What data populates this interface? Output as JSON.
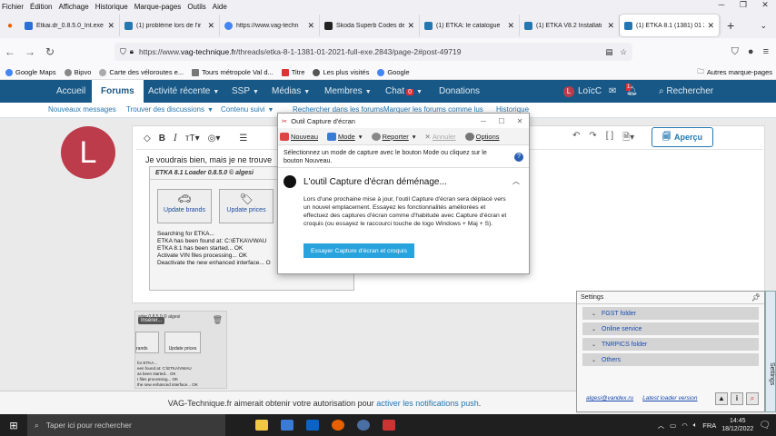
{
  "menubar": {
    "items": [
      "Fichier",
      "Édition",
      "Affichage",
      "Historique",
      "Marque-pages",
      "Outils",
      "Aide"
    ]
  },
  "tabs": [
    {
      "title": "Etkai.dr_0.8.5.0_Int.exe",
      "color": "#2b6fd6"
    },
    {
      "title": "(1) problème lors de l'ir",
      "color": "#2577b1"
    },
    {
      "title": "https://www.vag-techn",
      "color": "#4285f4"
    },
    {
      "title": "Skoda Superb Codes de",
      "color": "#222222"
    },
    {
      "title": "(1) ETKA: le catalogue",
      "color": "#2577b1"
    },
    {
      "title": "(1) ETKA V8.2 Installati",
      "color": "#2577b1"
    },
    {
      "title": "(1) ETKA 8.1 (1381) 01 2",
      "color": "#2577b1"
    }
  ],
  "browser": {
    "url_prefix": "https://www.",
    "url_domain": "vag-technique.fr",
    "url_path": "/threads/etka-8-1-1381-01-2021-full-exe.2843/page-2#post-49719"
  },
  "bookmarks": [
    "Google Maps",
    "Bipvo",
    "Carte des véloroutes e...",
    "Tours métropole Val d...",
    "Titre",
    "Les plus visités",
    "Google"
  ],
  "bookmarks_other": "Autres marque-pages",
  "sitenav": {
    "accueil": "Accueil",
    "forums": "Forums",
    "activite": "Activité récente",
    "ssp": "SSP",
    "medias": "Médias",
    "membres": "Membres",
    "chat": "Chat",
    "chat_badge": "0",
    "donations": "Donations",
    "user": "LoïcC",
    "user_initial": "L",
    "alert_badge": "1",
    "search": "Rechercher"
  },
  "subnav": [
    "Nouveaux messages",
    "Trouver des discussions",
    "Contenu suivi",
    "Rechercher dans les forums",
    "Marquer les forums comme lus",
    "Historique"
  ],
  "editor": {
    "preview": "Aperçu",
    "text": "Je voudrais bien, mais je ne trouve"
  },
  "etka_embed": {
    "title": "ETKA 8.1 Loader 0.8.5.0 © algesi",
    "btn_brands": "Update brands",
    "btn_prices": "Update prices",
    "log": [
      "Searching for ETKA...",
      "ETKA has been found at: C:\\ETKA\\VWAU",
      "ETKA 8.1 has been started... OK",
      "Activate VIN files processing... OK",
      "Deactivate the new enhanced interface... O"
    ]
  },
  "thumb": {
    "title": "ader 0.8.5.0 © algesi",
    "insert": "Insérer...",
    "btn_brands": "rands",
    "btn_prices": "Update prices",
    "log": [
      "for ETKA...",
      "een found at: C:\\ETKA\\VWAU",
      "as been started... OK",
      "I files processing... OK",
      "the new enhanced interface... OK"
    ]
  },
  "snip": {
    "title": "Outil Capture d'écran",
    "tool_new": "Nouveau",
    "tool_mode": "Mode",
    "tool_delay": "Reporter",
    "tool_cancel": "Annuler",
    "tool_options": "Options",
    "hint": "Sélectionnez un mode de capture avec le bouton Mode ou cliquez sur le bouton Nouveau.",
    "notice_title": "L'outil Capture d'écran déménage...",
    "notice_body": "Lors d'une prochaine mise à jour, l'outil Capture d'écran sera déplacé vers un nouvel emplacement. Essayez les fonctionnalités améliorées et effectuez des captures d'écran comme d'habitude avec Capture d'écran et croquis (ou essayez le raccourci touche de logo Windows + Maj + S).",
    "notice_button": "Essayer Capture d'écran et croquis"
  },
  "settings": {
    "title": "Settings",
    "items": [
      "FGST folder",
      "Online service",
      "TNRPICS folder",
      "Others"
    ],
    "email": "algesi@vandex.ru",
    "latest": "Latest loader version",
    "side_tab": "Settings"
  },
  "notification": {
    "text": "VAG-Technique.fr aimerait obtenir votre autorisation pour ",
    "link": "activer les notifications push",
    "end": "."
  },
  "taskbar": {
    "search": "Taper ici pour rechercher",
    "lang": "FRA",
    "time": "14:45",
    "date": "18/12/2022"
  }
}
